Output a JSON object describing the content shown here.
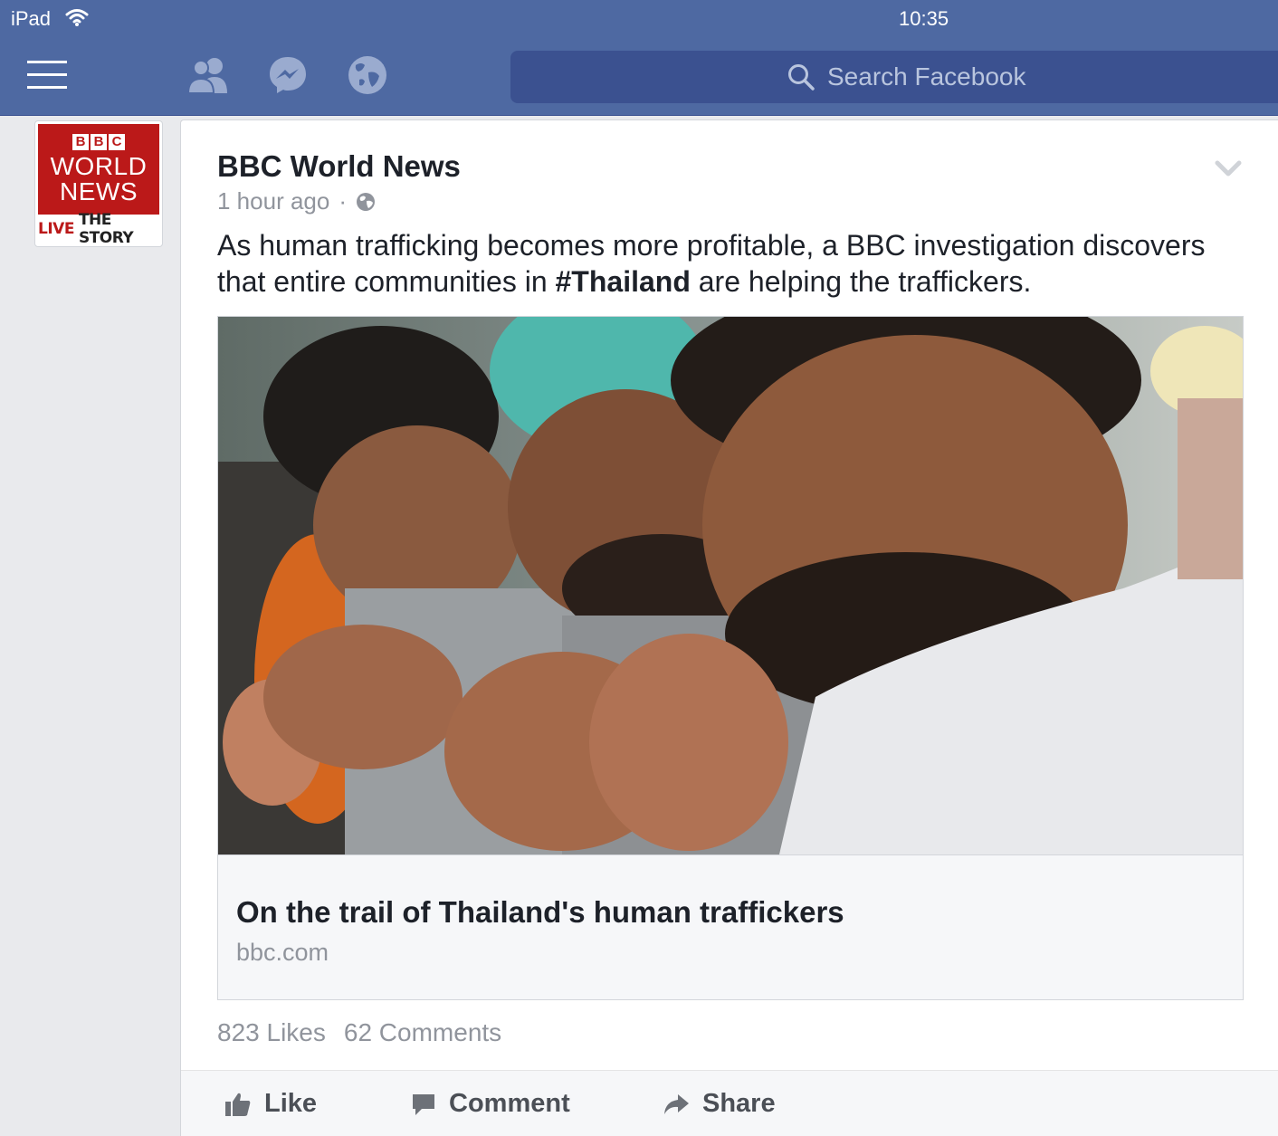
{
  "statusbar": {
    "device": "iPad",
    "time": "10:35"
  },
  "navbar": {
    "search_placeholder": "Search Facebook"
  },
  "avatar": {
    "line1": "WORLD",
    "line2": "NEWS",
    "bbc_letters": [
      "B",
      "B",
      "C"
    ],
    "tag_live": "LIVE",
    "tag_rest": "THE STORY"
  },
  "post": {
    "page_name": "BBC World News",
    "time": "1 hour ago",
    "text_before": "As human trafficking becomes more profitable, a BBC investigation discovers that entire communities in ",
    "hashtag": "#Thailand",
    "text_after": " are helping the traffickers.",
    "link_title": "On the trail of Thailand's human traffickers",
    "link_domain": "bbc.com",
    "likes": "823 Likes",
    "comments": "62 Comments"
  },
  "actions": {
    "like": "Like",
    "comment": "Comment",
    "share": "Share"
  },
  "colors": {
    "brand_blue": "#4e69a2",
    "search_bg": "#3b5190",
    "bbc_red": "#bb1919"
  },
  "icons": [
    "wifi-icon",
    "menu-icon",
    "friends-icon",
    "messenger-icon",
    "globe-icon",
    "search-icon",
    "public-globe-icon",
    "chevron-down-icon",
    "like-icon",
    "comment-icon",
    "share-icon"
  ]
}
